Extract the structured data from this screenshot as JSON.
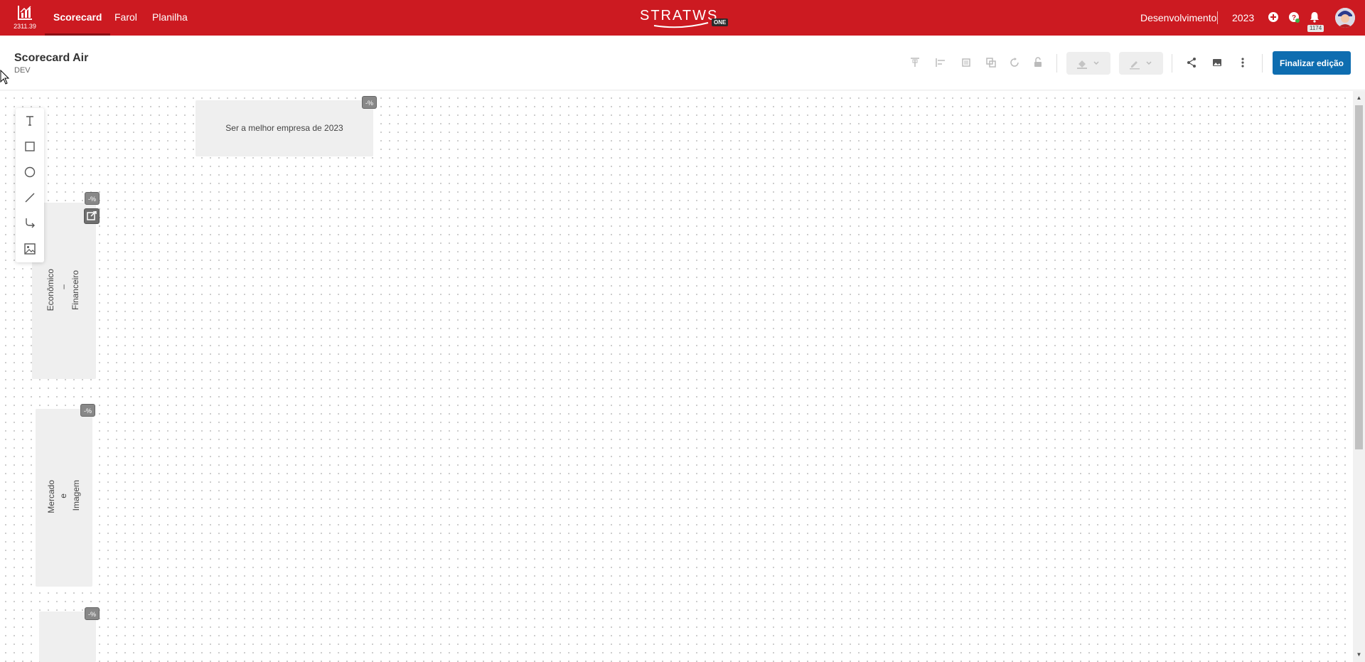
{
  "app": {
    "version": "2311.39",
    "tabs": [
      {
        "label": "Scorecard",
        "active": true
      },
      {
        "label": "Farol",
        "active": false
      },
      {
        "label": "Planilha",
        "active": false
      }
    ],
    "logo_text": "STRATWS",
    "logo_badge": "ONE",
    "environment": "Desenvolvimento",
    "year": "2023",
    "notifications_count": "1174",
    "colors": {
      "brand_red": "#cc1a21",
      "primary_button": "#0e6db0"
    }
  },
  "page": {
    "title": "Scorecard Air",
    "subtitle": "DEV",
    "finish_button": "Finalizar edição"
  },
  "toolbar": {
    "icons": [
      "align-top-icon",
      "align-left-icon",
      "bring-front-icon",
      "duplicate-icon",
      "rotate-icon",
      "unlock-icon",
      "fill-color-icon",
      "stroke-color-icon",
      "share-icon",
      "image-export-icon",
      "more-icon"
    ]
  },
  "tools": [
    "text-tool-icon",
    "rectangle-tool-icon",
    "ellipse-tool-icon",
    "line-tool-icon",
    "connector-tool-icon",
    "image-tool-icon"
  ],
  "canvas": {
    "vision_card": {
      "text": "Ser a melhor empresa de 2023",
      "badge": "-%"
    },
    "perspectives": [
      {
        "lines": [
          "Econômico",
          "–",
          "Financeiro"
        ],
        "badge": "-%"
      },
      {
        "lines": [
          "Mercado",
          "e",
          "Imagem"
        ],
        "badge": "-%"
      },
      {
        "lines": [],
        "badge": "-%"
      }
    ]
  }
}
